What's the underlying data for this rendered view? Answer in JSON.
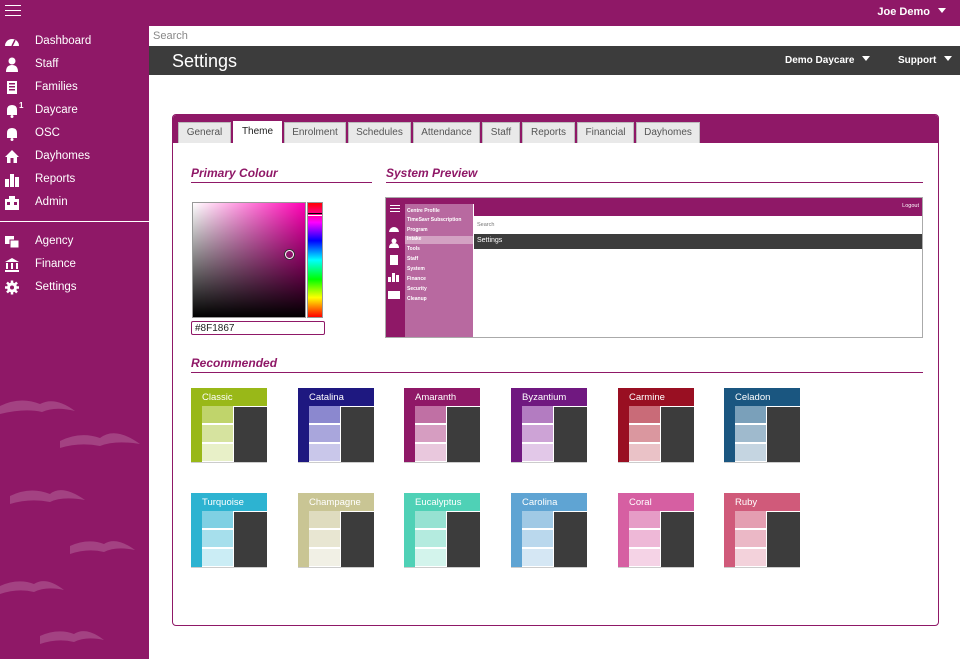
{
  "topbar": {
    "user": "Joe Demo",
    "menu_icon": "hamburger-icon"
  },
  "sidebar": {
    "items": [
      {
        "label": "Dashboard",
        "icon": "dashboard-gauge-icon"
      },
      {
        "label": "Staff",
        "icon": "person-icon"
      },
      {
        "label": "Families",
        "icon": "family-icon"
      },
      {
        "label": "Daycare",
        "icon": "bell-icon",
        "badge": "1"
      },
      {
        "label": "OSC",
        "icon": "bell-icon"
      },
      {
        "label": "Dayhomes",
        "icon": "house-icon"
      },
      {
        "label": "Reports",
        "icon": "bar-chart-icon"
      },
      {
        "label": "Admin",
        "icon": "admin-building-icon"
      }
    ],
    "items2": [
      {
        "label": "Agency",
        "icon": "agency-icon"
      },
      {
        "label": "Finance",
        "icon": "bank-icon"
      },
      {
        "label": "Settings",
        "icon": "gear-icon"
      }
    ]
  },
  "search": {
    "placeholder": "Search"
  },
  "header": {
    "title": "Settings",
    "center_dropdown": "Demo Daycare",
    "support_dropdown": "Support"
  },
  "tabs": [
    "General",
    "Theme",
    "Enrolment",
    "Schedules",
    "Attendance",
    "Staff",
    "Reports",
    "Financial",
    "Dayhomes"
  ],
  "active_tab": "Theme",
  "primary": {
    "title": "Primary Colour",
    "hex": "#8F1867"
  },
  "preview": {
    "title": "System Preview",
    "logout": "Logout",
    "search": "Search",
    "header": "Settings",
    "menu": [
      "Centre Profile",
      "TimeSavr Subscription",
      "Program",
      "Intake",
      "Tools",
      "Staff",
      "System",
      "Finance",
      "Security",
      "Cleanup"
    ],
    "highlighted": "Intake"
  },
  "recommended": {
    "title": "Recommended",
    "themes": [
      {
        "name": "Classic",
        "color": "#99b818",
        "tints": [
          "#c0d46b",
          "#d6e39f",
          "#e8f0c8"
        ]
      },
      {
        "name": "Catalina",
        "color": "#1e1880",
        "tints": [
          "#8b88cf",
          "#a9a6dc",
          "#c9c7ea"
        ]
      },
      {
        "name": "Amaranth",
        "color": "#8f1867",
        "tints": [
          "#c070a4",
          "#d69dc1",
          "#e9c8dd"
        ]
      },
      {
        "name": "Byzantium",
        "color": "#701880",
        "tints": [
          "#b37cc1",
          "#cda3d6",
          "#e2c8e8"
        ]
      },
      {
        "name": "Carmine",
        "color": "#990f22",
        "tints": [
          "#c96b78",
          "#da979f",
          "#eac2c7"
        ]
      },
      {
        "name": "Celadon",
        "color": "#1a5680",
        "tints": [
          "#7aa0ba",
          "#9fbacd",
          "#c5d5e1"
        ]
      },
      {
        "name": "Turquoise",
        "color": "#2db3d1",
        "tints": [
          "#7fd0e3",
          "#a6dfec",
          "#cbedf5"
        ]
      },
      {
        "name": "Champagne",
        "color": "#c9c594",
        "tints": [
          "#dfdcbf",
          "#e8e6d2",
          "#f1f0e5"
        ]
      },
      {
        "name": "Eucalyptus",
        "color": "#4fd1b6",
        "tints": [
          "#96e2d2",
          "#b4ebdf",
          "#d3f4ec"
        ]
      },
      {
        "name": "Carolina",
        "color": "#5fa4d3",
        "tints": [
          "#a0c9e5",
          "#bad8ed",
          "#d5e7f4"
        ]
      },
      {
        "name": "Coral",
        "color": "#d65fa2",
        "tints": [
          "#e69cc6",
          "#eeb8d7",
          "#f5d3e6"
        ]
      },
      {
        "name": "Ruby",
        "color": "#d05a7a",
        "tints": [
          "#e49eb1",
          "#ebb8c6",
          "#f3d2db"
        ]
      }
    ]
  }
}
